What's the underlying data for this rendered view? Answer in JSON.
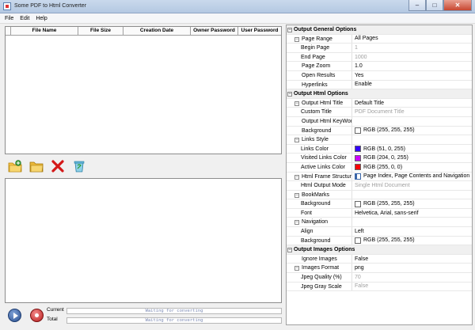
{
  "window": {
    "title": "Some PDF to Html Converter"
  },
  "menu": {
    "items": [
      "File",
      "Edit",
      "Help"
    ]
  },
  "file_list": {
    "columns": [
      "File Name",
      "File Size",
      "Creation Date",
      "Owner Password",
      "User Password"
    ],
    "rows": []
  },
  "toolbar": {
    "icons": [
      "add-file-icon",
      "add-folder-icon",
      "remove-icon",
      "clear-icon"
    ]
  },
  "progress": {
    "current_label": "Current",
    "total_label": "Total",
    "current_text": "Waiting for converting",
    "total_text": "Waiting for converting"
  },
  "properties": [
    {
      "type": "category",
      "name": "Output General Options"
    },
    {
      "type": "prop",
      "level": 1,
      "name": "Page Range",
      "value": "All Pages",
      "expandable": true
    },
    {
      "type": "prop",
      "level": 2,
      "name": "Begin Page",
      "value": "1",
      "dim": true
    },
    {
      "type": "prop",
      "level": 2,
      "name": "End Page",
      "value": "1000",
      "dim": true
    },
    {
      "type": "prop",
      "level": 1,
      "name": "Page Zoom",
      "value": "1.0"
    },
    {
      "type": "prop",
      "level": 1,
      "name": "Open Results",
      "value": "Yes"
    },
    {
      "type": "prop",
      "level": 1,
      "name": "Hyperlinks",
      "value": "Enable"
    },
    {
      "type": "category",
      "name": "Output Html Options"
    },
    {
      "type": "prop",
      "level": 1,
      "name": "Output Html Title",
      "value": "Default Title",
      "expandable": true
    },
    {
      "type": "prop",
      "level": 2,
      "name": "Custom Title",
      "value": "PDF Document Title",
      "dim": true
    },
    {
      "type": "prop",
      "level": 1,
      "name": "Output Html KeyWords",
      "value": ""
    },
    {
      "type": "prop",
      "level": 1,
      "name": "Background",
      "value": "RGB (255, 255, 255)",
      "swatch": "#ffffff"
    },
    {
      "type": "prop",
      "level": 1,
      "name": "Links Style",
      "value": "",
      "expandable": true
    },
    {
      "type": "prop",
      "level": 2,
      "name": "Links Color",
      "value": "RGB (51, 0, 255)",
      "swatch": "#3300ff"
    },
    {
      "type": "prop",
      "level": 2,
      "name": "Visited Links Color",
      "value": "RGB (204, 0, 255)",
      "swatch": "#cc00ff"
    },
    {
      "type": "prop",
      "level": 2,
      "name": "Active Links Color",
      "value": "RGB (255, 0, 0)",
      "swatch": "#ff0000"
    },
    {
      "type": "prop",
      "level": 1,
      "name": "Html Frame Structures",
      "value": "Page Index, Page Contents and Navigation",
      "icon": "frame-layout-icon",
      "expandable": true
    },
    {
      "type": "prop",
      "level": 2,
      "name": "Html Output Mode",
      "value": "Single Html Document",
      "dim": true
    },
    {
      "type": "prop",
      "level": 1,
      "name": "BookMarks",
      "value": "",
      "expandable": true
    },
    {
      "type": "prop",
      "level": 2,
      "name": "Background",
      "value": "RGB (255, 255, 255)",
      "swatch": "#ffffff"
    },
    {
      "type": "prop",
      "level": 2,
      "name": "Font",
      "value": "Helvetica, Arial, sans-serif"
    },
    {
      "type": "prop",
      "level": 1,
      "name": "Navigation",
      "value": "",
      "expandable": true
    },
    {
      "type": "prop",
      "level": 2,
      "name": "Align",
      "value": "Left"
    },
    {
      "type": "prop",
      "level": 2,
      "name": "Background",
      "value": "RGB (255, 255, 255)",
      "swatch": "#ffffff"
    },
    {
      "type": "category",
      "name": "Output Images Options"
    },
    {
      "type": "prop",
      "level": 1,
      "name": "Ignore Images",
      "value": "False"
    },
    {
      "type": "prop",
      "level": 1,
      "name": "Images Format",
      "value": "png",
      "expandable": true
    },
    {
      "type": "prop",
      "level": 2,
      "name": "Jpeg Quality (%)",
      "value": "70",
      "dim": true
    },
    {
      "type": "prop",
      "level": 2,
      "name": "Jpeg Gray Scale",
      "value": "False",
      "dim": true
    }
  ]
}
